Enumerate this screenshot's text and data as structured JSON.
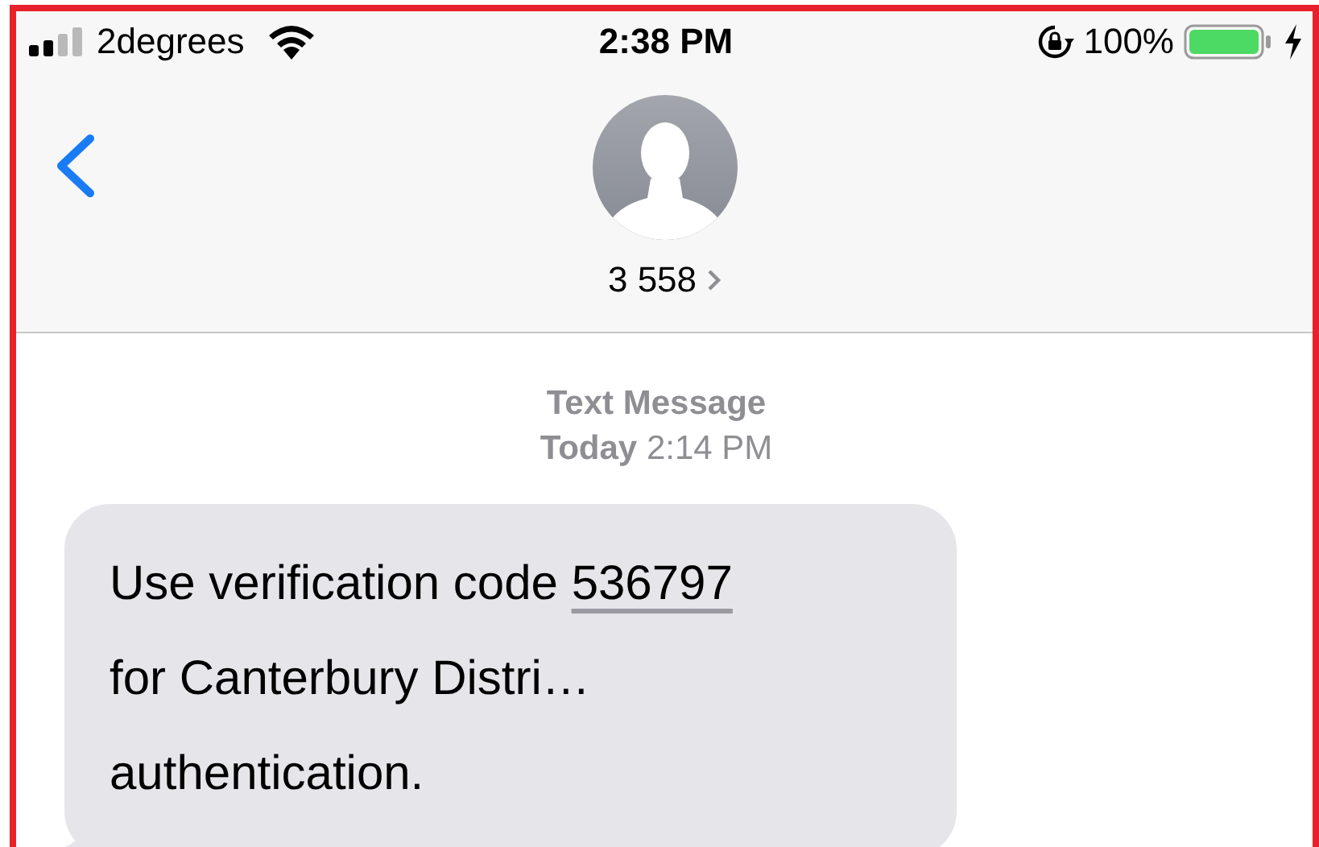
{
  "status_bar": {
    "carrier": "2degrees",
    "time": "2:38 PM",
    "battery": "100%"
  },
  "header": {
    "contact": "3 558"
  },
  "thread": {
    "label": "Text Message",
    "timestamp": "**Today** 2:14 PM"
  },
  "message": {
    "text_start": "Use verification code ",
    "code": "536797",
    "lines": [
      "for Canterbury Distri…",
      "authentication."
    ]
  }
}
